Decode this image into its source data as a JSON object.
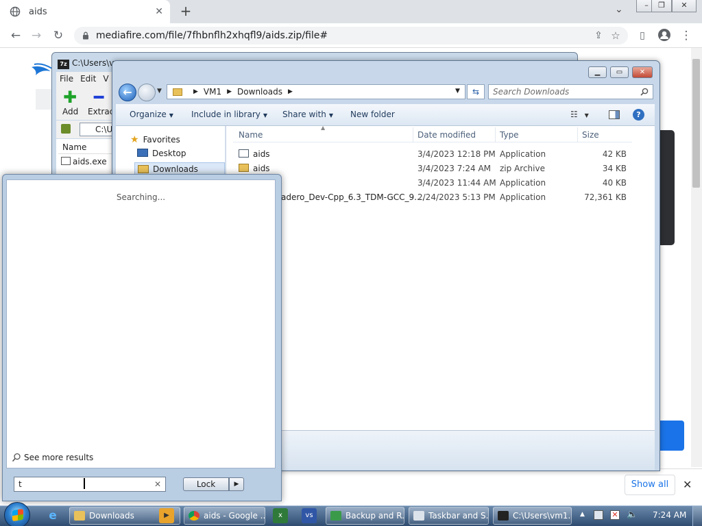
{
  "browser": {
    "tab_title": "aids",
    "url": "mediafire.com/file/7fhbnflh2xhqfl9/aids.zip/file#",
    "download_bar": {
      "show_all_label": "Show all"
    }
  },
  "sevenzip": {
    "title": "C:\\Users\\vm",
    "logo_text": "7z",
    "menu": [
      "File",
      "Edit",
      "V"
    ],
    "add_label": "Add",
    "extract_label": "Extract",
    "path_value": "C:\\U",
    "column_name": "Name",
    "file_name": "aids.exe"
  },
  "explorer": {
    "breadcrumb": [
      "VM1",
      "Downloads"
    ],
    "search_placeholder": "Search Downloads",
    "commands": [
      "Organize",
      "Include in library",
      "Share with",
      "New folder"
    ],
    "nav": {
      "favorites": "Favorites",
      "desktop": "Desktop",
      "downloads": "Downloads"
    },
    "columns": {
      "name": "Name",
      "date": "Date modified",
      "type": "Type",
      "size": "Size"
    },
    "files": [
      {
        "name": "aids",
        "date": "3/4/2023 12:18 PM",
        "type": "Application",
        "size": "42 KB"
      },
      {
        "name": "aids",
        "date": "3/4/2023 7:24 AM",
        "type": "zip Archive",
        "size": "34 KB"
      },
      {
        "name": "",
        "date": "3/4/2023 11:44 AM",
        "type": "Application",
        "size": "40 KB"
      },
      {
        "name": "adero_Dev-Cpp_6.3_TDM-GCC_9....",
        "date": "2/24/2023 5:13 PM",
        "type": "Application",
        "size": "72,361 KB"
      }
    ]
  },
  "startmenu": {
    "status": "Searching...",
    "see_more": "See more results",
    "search_value": "t",
    "lock_label": "Lock"
  },
  "taskbar": {
    "items": [
      "Downloads",
      "aids - Google ...",
      "Backup and R...",
      "Taskbar and S...",
      "C:\\Users\\vm1..."
    ],
    "clock": "7:24 AM"
  },
  "colors": {
    "accent": "#1a73e8",
    "taskbar": "#2f4c70"
  }
}
